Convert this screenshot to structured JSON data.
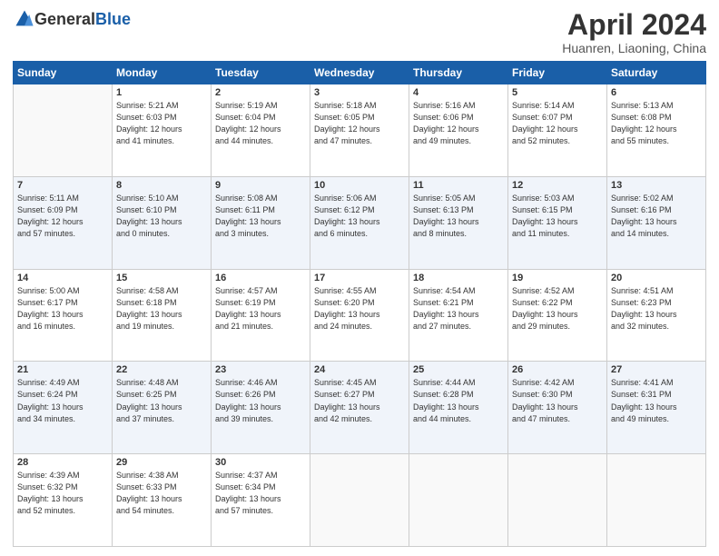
{
  "header": {
    "logo_general": "General",
    "logo_blue": "Blue",
    "title": "April 2024",
    "subtitle": "Huanren, Liaoning, China"
  },
  "columns": [
    "Sunday",
    "Monday",
    "Tuesday",
    "Wednesday",
    "Thursday",
    "Friday",
    "Saturday"
  ],
  "weeks": [
    [
      {
        "day": "",
        "sunrise": "",
        "sunset": "",
        "daylight": ""
      },
      {
        "day": "1",
        "sunrise": "Sunrise: 5:21 AM",
        "sunset": "Sunset: 6:03 PM",
        "daylight": "Daylight: 12 hours and 41 minutes."
      },
      {
        "day": "2",
        "sunrise": "Sunrise: 5:19 AM",
        "sunset": "Sunset: 6:04 PM",
        "daylight": "Daylight: 12 hours and 44 minutes."
      },
      {
        "day": "3",
        "sunrise": "Sunrise: 5:18 AM",
        "sunset": "Sunset: 6:05 PM",
        "daylight": "Daylight: 12 hours and 47 minutes."
      },
      {
        "day": "4",
        "sunrise": "Sunrise: 5:16 AM",
        "sunset": "Sunset: 6:06 PM",
        "daylight": "Daylight: 12 hours and 49 minutes."
      },
      {
        "day": "5",
        "sunrise": "Sunrise: 5:14 AM",
        "sunset": "Sunset: 6:07 PM",
        "daylight": "Daylight: 12 hours and 52 minutes."
      },
      {
        "day": "6",
        "sunrise": "Sunrise: 5:13 AM",
        "sunset": "Sunset: 6:08 PM",
        "daylight": "Daylight: 12 hours and 55 minutes."
      }
    ],
    [
      {
        "day": "7",
        "sunrise": "Sunrise: 5:11 AM",
        "sunset": "Sunset: 6:09 PM",
        "daylight": "Daylight: 12 hours and 57 minutes."
      },
      {
        "day": "8",
        "sunrise": "Sunrise: 5:10 AM",
        "sunset": "Sunset: 6:10 PM",
        "daylight": "Daylight: 13 hours and 0 minutes."
      },
      {
        "day": "9",
        "sunrise": "Sunrise: 5:08 AM",
        "sunset": "Sunset: 6:11 PM",
        "daylight": "Daylight: 13 hours and 3 minutes."
      },
      {
        "day": "10",
        "sunrise": "Sunrise: 5:06 AM",
        "sunset": "Sunset: 6:12 PM",
        "daylight": "Daylight: 13 hours and 6 minutes."
      },
      {
        "day": "11",
        "sunrise": "Sunrise: 5:05 AM",
        "sunset": "Sunset: 6:13 PM",
        "daylight": "Daylight: 13 hours and 8 minutes."
      },
      {
        "day": "12",
        "sunrise": "Sunrise: 5:03 AM",
        "sunset": "Sunset: 6:15 PM",
        "daylight": "Daylight: 13 hours and 11 minutes."
      },
      {
        "day": "13",
        "sunrise": "Sunrise: 5:02 AM",
        "sunset": "Sunset: 6:16 PM",
        "daylight": "Daylight: 13 hours and 14 minutes."
      }
    ],
    [
      {
        "day": "14",
        "sunrise": "Sunrise: 5:00 AM",
        "sunset": "Sunset: 6:17 PM",
        "daylight": "Daylight: 13 hours and 16 minutes."
      },
      {
        "day": "15",
        "sunrise": "Sunrise: 4:58 AM",
        "sunset": "Sunset: 6:18 PM",
        "daylight": "Daylight: 13 hours and 19 minutes."
      },
      {
        "day": "16",
        "sunrise": "Sunrise: 4:57 AM",
        "sunset": "Sunset: 6:19 PM",
        "daylight": "Daylight: 13 hours and 21 minutes."
      },
      {
        "day": "17",
        "sunrise": "Sunrise: 4:55 AM",
        "sunset": "Sunset: 6:20 PM",
        "daylight": "Daylight: 13 hours and 24 minutes."
      },
      {
        "day": "18",
        "sunrise": "Sunrise: 4:54 AM",
        "sunset": "Sunset: 6:21 PM",
        "daylight": "Daylight: 13 hours and 27 minutes."
      },
      {
        "day": "19",
        "sunrise": "Sunrise: 4:52 AM",
        "sunset": "Sunset: 6:22 PM",
        "daylight": "Daylight: 13 hours and 29 minutes."
      },
      {
        "day": "20",
        "sunrise": "Sunrise: 4:51 AM",
        "sunset": "Sunset: 6:23 PM",
        "daylight": "Daylight: 13 hours and 32 minutes."
      }
    ],
    [
      {
        "day": "21",
        "sunrise": "Sunrise: 4:49 AM",
        "sunset": "Sunset: 6:24 PM",
        "daylight": "Daylight: 13 hours and 34 minutes."
      },
      {
        "day": "22",
        "sunrise": "Sunrise: 4:48 AM",
        "sunset": "Sunset: 6:25 PM",
        "daylight": "Daylight: 13 hours and 37 minutes."
      },
      {
        "day": "23",
        "sunrise": "Sunrise: 4:46 AM",
        "sunset": "Sunset: 6:26 PM",
        "daylight": "Daylight: 13 hours and 39 minutes."
      },
      {
        "day": "24",
        "sunrise": "Sunrise: 4:45 AM",
        "sunset": "Sunset: 6:27 PM",
        "daylight": "Daylight: 13 hours and 42 minutes."
      },
      {
        "day": "25",
        "sunrise": "Sunrise: 4:44 AM",
        "sunset": "Sunset: 6:28 PM",
        "daylight": "Daylight: 13 hours and 44 minutes."
      },
      {
        "day": "26",
        "sunrise": "Sunrise: 4:42 AM",
        "sunset": "Sunset: 6:30 PM",
        "daylight": "Daylight: 13 hours and 47 minutes."
      },
      {
        "day": "27",
        "sunrise": "Sunrise: 4:41 AM",
        "sunset": "Sunset: 6:31 PM",
        "daylight": "Daylight: 13 hours and 49 minutes."
      }
    ],
    [
      {
        "day": "28",
        "sunrise": "Sunrise: 4:39 AM",
        "sunset": "Sunset: 6:32 PM",
        "daylight": "Daylight: 13 hours and 52 minutes."
      },
      {
        "day": "29",
        "sunrise": "Sunrise: 4:38 AM",
        "sunset": "Sunset: 6:33 PM",
        "daylight": "Daylight: 13 hours and 54 minutes."
      },
      {
        "day": "30",
        "sunrise": "Sunrise: 4:37 AM",
        "sunset": "Sunset: 6:34 PM",
        "daylight": "Daylight: 13 hours and 57 minutes."
      },
      {
        "day": "",
        "sunrise": "",
        "sunset": "",
        "daylight": ""
      },
      {
        "day": "",
        "sunrise": "",
        "sunset": "",
        "daylight": ""
      },
      {
        "day": "",
        "sunrise": "",
        "sunset": "",
        "daylight": ""
      },
      {
        "day": "",
        "sunrise": "",
        "sunset": "",
        "daylight": ""
      }
    ]
  ]
}
